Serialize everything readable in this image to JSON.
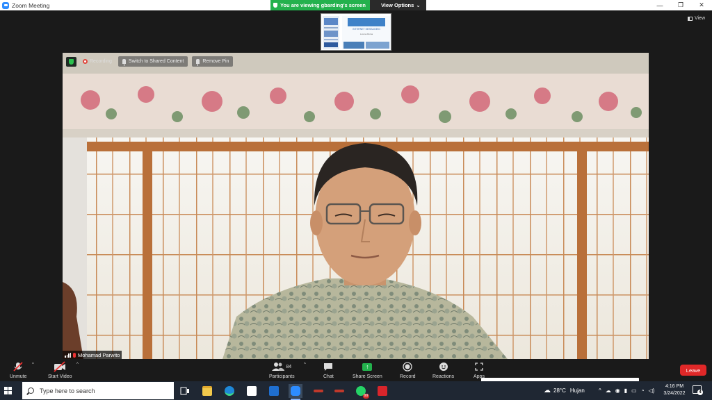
{
  "window": {
    "title": "Zoom Meeting",
    "controls": [
      "minimize",
      "restore",
      "close"
    ]
  },
  "banner": {
    "viewing_text": "You are viewing gbarding's screen",
    "view_options_label": "View Options"
  },
  "view_button": {
    "label": "View"
  },
  "video": {
    "recording_label": "Recording",
    "switch_label": "Switch to Shared Content",
    "remove_pin_label": "Remove Pin",
    "participant_name": "Mohamad Parwito"
  },
  "thumbnail": {
    "heading": "INTERNET MESSAGING",
    "subheading": "Lorena Roma"
  },
  "toolbar": {
    "unmute_label": "Unmute",
    "start_video_label": "Start Video",
    "participants_label": "Participants",
    "participants_count": "84",
    "chat_label": "Chat",
    "share_label": "Share Screen",
    "record_label": "Record",
    "reactions_label": "Reactions",
    "apps_label": "Apps",
    "leave_label": "Leave"
  },
  "taskbar": {
    "search_placeholder": "Type here to search",
    "whatsapp_badge": "99",
    "weather_temp": "28°C",
    "weather_desc": "Hujan",
    "time": "4:16 PM",
    "date": "3/24/2022",
    "notification_count": "4"
  },
  "colors": {
    "zoom_blue": "#2d8cff",
    "banner_green": "#23b14d",
    "leave_red": "#e02828",
    "taskbar": "#1f2733"
  }
}
